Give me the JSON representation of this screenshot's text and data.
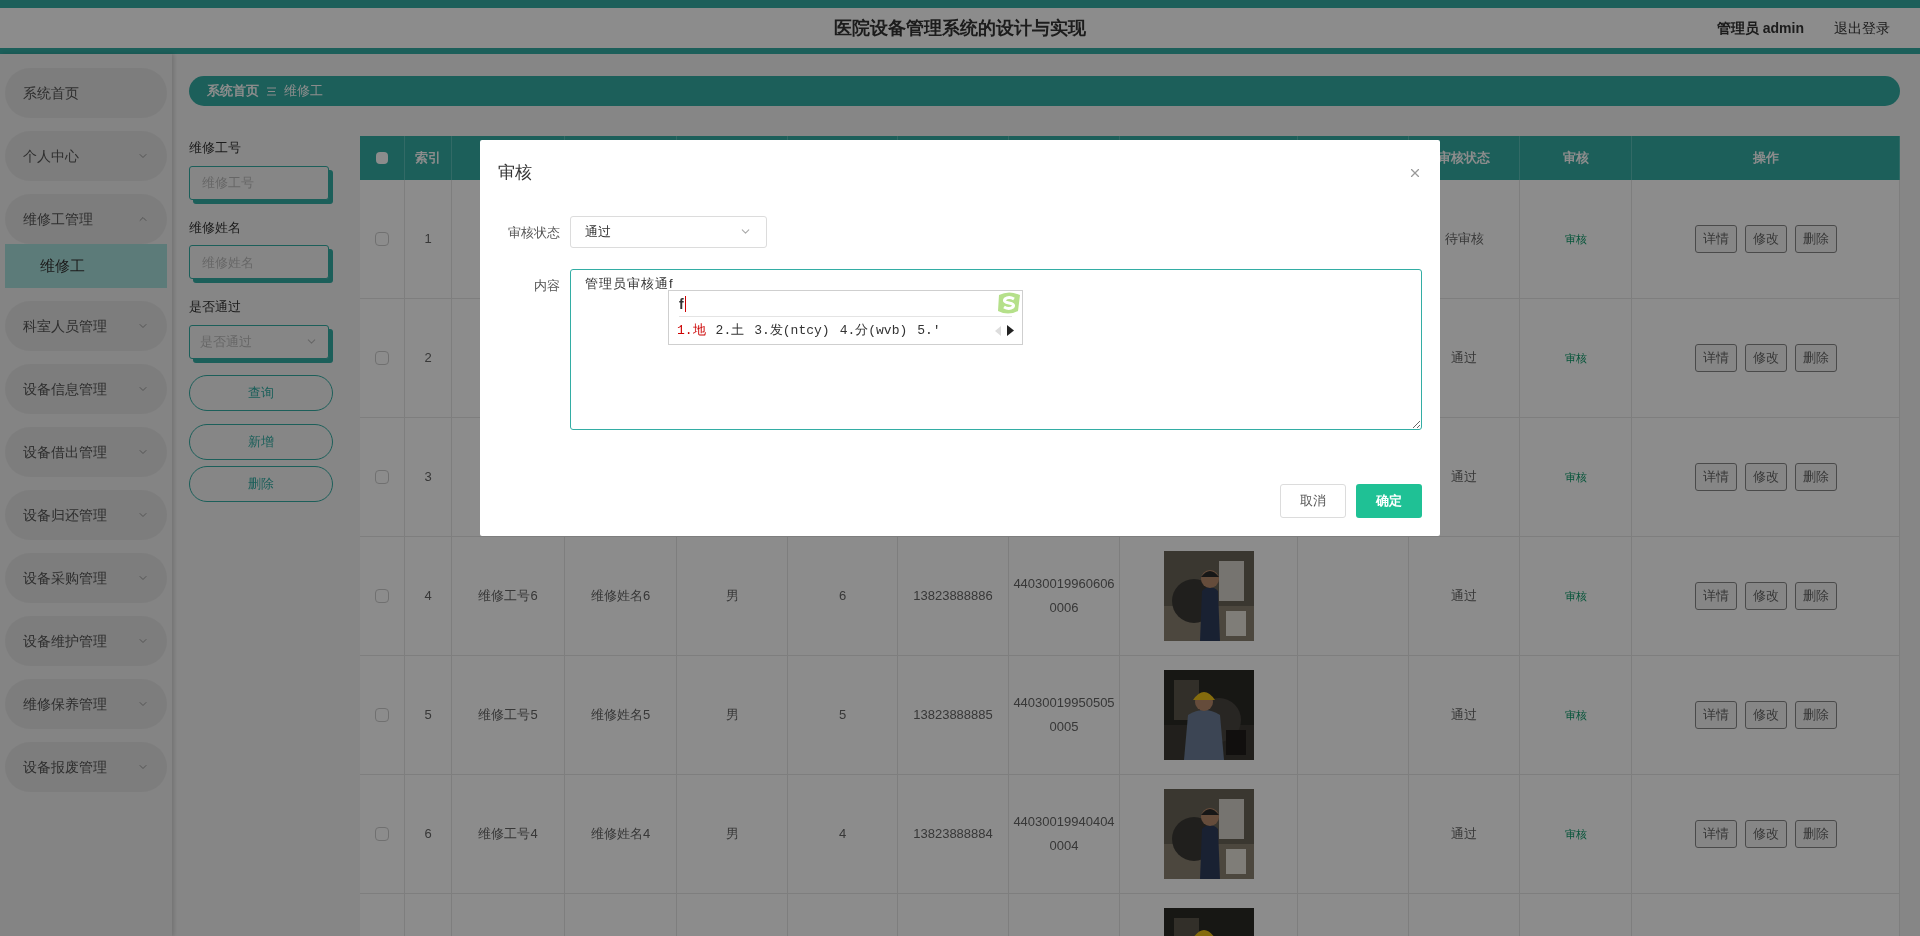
{
  "header": {
    "title": "医院设备管理系统的设计与实现",
    "user": "管理员 admin",
    "logout": "退出登录"
  },
  "sidebar": {
    "items": [
      {
        "label": "系统首页",
        "kind": "link"
      },
      {
        "label": "个人中心",
        "kind": "menu",
        "expanded": false
      },
      {
        "label": "维修工管理",
        "kind": "menu",
        "expanded": true,
        "children": [
          {
            "label": "维修工",
            "selected": true
          }
        ]
      },
      {
        "label": "科室人员管理",
        "kind": "menu",
        "expanded": false
      },
      {
        "label": "设备信息管理",
        "kind": "menu",
        "expanded": false
      },
      {
        "label": "设备借出管理",
        "kind": "menu",
        "expanded": false
      },
      {
        "label": "设备归还管理",
        "kind": "menu",
        "expanded": false
      },
      {
        "label": "设备采购管理",
        "kind": "menu",
        "expanded": false
      },
      {
        "label": "设备维护管理",
        "kind": "menu",
        "expanded": false
      },
      {
        "label": "维修保养管理",
        "kind": "menu",
        "expanded": false
      },
      {
        "label": "设备报废管理",
        "kind": "menu",
        "expanded": false
      }
    ]
  },
  "breadcrumb": {
    "home": "系统首页",
    "current": "维修工"
  },
  "search": {
    "fields": [
      {
        "label": "维修工号",
        "placeholder": "维修工号",
        "kind": "input"
      },
      {
        "label": "维修姓名",
        "placeholder": "维修姓名",
        "kind": "input"
      },
      {
        "label": "是否通过",
        "placeholder": "是否通过",
        "kind": "select"
      }
    ],
    "buttons": [
      "查询",
      "新增",
      "删除"
    ]
  },
  "table": {
    "header_checked": false,
    "columns": [
      {
        "kind": "text",
        "label": "索引"
      },
      {
        "kind": "text"
      },
      {
        "kind": "text"
      },
      {
        "kind": "text"
      },
      {
        "kind": "text"
      },
      {
        "kind": "text"
      },
      {
        "kind": "text"
      },
      {
        "kind": "picture"
      },
      {
        "kind": "text"
      },
      {
        "kind": "text",
        "label": "审核状态"
      },
      {
        "kind": "link",
        "label": "审核"
      },
      {
        "kind": "actions",
        "label": "操作"
      }
    ],
    "rows": [
      {
        "checked": false,
        "cells": [
          "1",
          null,
          null,
          null,
          null,
          null,
          null,
          null,
          null,
          "待审核",
          "审核",
          [
            "详情",
            "修改",
            "删除"
          ]
        ]
      },
      {
        "checked": false,
        "cells": [
          "2",
          null,
          null,
          null,
          null,
          null,
          null,
          null,
          null,
          "通过",
          "审核",
          [
            "详情",
            "修改",
            "删除"
          ]
        ]
      },
      {
        "checked": false,
        "cells": [
          "3",
          null,
          null,
          null,
          null,
          null,
          null,
          null,
          null,
          "通过",
          "审核",
          [
            "详情",
            "修改",
            "删除"
          ]
        ]
      },
      {
        "checked": false,
        "cells": [
          "4",
          "维修工号6",
          "维修姓名6",
          "男",
          "6",
          "13823888886",
          "440300199606060006",
          {
            "kind": "picture"
          },
          null,
          "通过",
          "审核",
          [
            "详情",
            "修改",
            "删除"
          ]
        ]
      },
      {
        "checked": false,
        "cells": [
          "5",
          "维修工号5",
          "维修姓名5",
          "男",
          "5",
          "13823888885",
          "440300199505050005",
          {
            "kind": "picture"
          },
          null,
          "通过",
          "审核",
          [
            "详情",
            "修改",
            "删除"
          ]
        ]
      },
      {
        "checked": false,
        "cells": [
          "6",
          "维修工号4",
          "维修姓名4",
          "男",
          "4",
          "13823888884",
          "440300199404040004",
          {
            "kind": "picture"
          },
          null,
          "通过",
          "审核",
          [
            "详情",
            "修改",
            "删除"
          ]
        ]
      },
      {
        "cells": [
          null,
          null,
          null,
          null,
          null,
          null,
          null,
          {
            "kind": "picture"
          },
          null,
          null,
          null,
          null
        ]
      }
    ]
  },
  "dialog": {
    "title": "审核",
    "fields": [
      {
        "label": "审核状态",
        "kind": "select",
        "value": "通过"
      },
      {
        "label": "内容",
        "kind": "textarea",
        "value": "管理员审核通f"
      }
    ],
    "buttons": [
      {
        "label": "取消",
        "kind": "default"
      },
      {
        "label": "确定",
        "kind": "primary"
      }
    ]
  },
  "ime": {
    "composition": "f",
    "candidates": [
      {
        "text": "1.地",
        "selected": true
      },
      {
        "text": "2.土",
        "selected": false
      },
      {
        "text": "3.发(ntcy)",
        "selected": false
      },
      {
        "text": "4.分(wvb)",
        "selected": false
      },
      {
        "text": "5.′",
        "selected": false
      }
    ]
  }
}
